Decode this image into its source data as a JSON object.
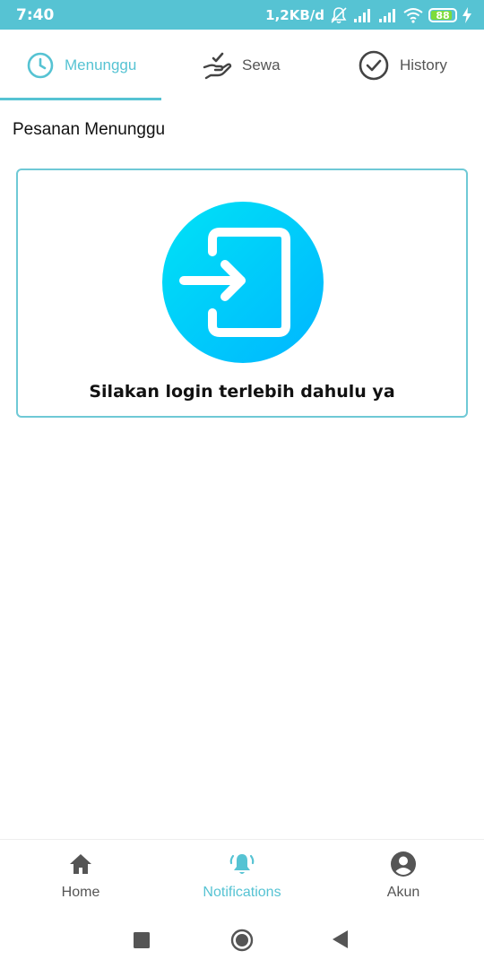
{
  "status_bar": {
    "time": "7:40",
    "net_speed": "1,2KB/d",
    "battery_level": "88",
    "battery_fraction": 0.88,
    "icons": [
      "mute-bell-icon",
      "signal-icon",
      "signal-icon",
      "wifi-icon",
      "battery-icon",
      "charging-bolt-icon"
    ]
  },
  "tabs": [
    {
      "label": "Menunggu",
      "icon": "clock-icon",
      "active": true
    },
    {
      "label": "Sewa",
      "icon": "hand-check-icon",
      "active": false
    },
    {
      "label": "History",
      "icon": "check-circle-icon",
      "active": false
    }
  ],
  "section_title": "Pesanan Menunggu",
  "card": {
    "icon": "login-icon",
    "message": "Silakan login terlebih dahulu ya"
  },
  "bottom_nav": [
    {
      "label": "Home",
      "icon": "home-icon",
      "active": false
    },
    {
      "label": "Notifications",
      "icon": "bell-ringing-icon",
      "active": true
    },
    {
      "label": "Akun",
      "icon": "account-icon",
      "active": false
    }
  ],
  "system_nav": [
    "recents-square-icon",
    "home-circle-icon",
    "back-triangle-icon"
  ],
  "colors": {
    "accent": "#56c3d3",
    "status_bar": "#56c3d3",
    "gradient_start": "#00e2f6",
    "gradient_end": "#00b6ff",
    "battery_fill": "#7ddc3a"
  }
}
